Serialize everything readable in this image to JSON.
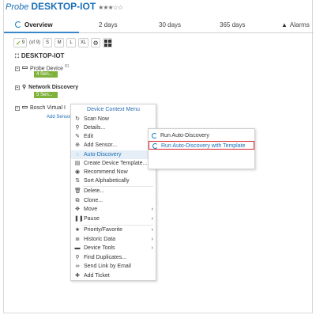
{
  "title": {
    "prefix": "Probe",
    "name": "DESKTOP-IOT",
    "stars": "★★★☆☆"
  },
  "tabs": [
    {
      "label": "Overview",
      "icon": "spinner-icon",
      "active": true
    },
    {
      "label": "2  days",
      "active": false
    },
    {
      "label": "30  days",
      "active": false
    },
    {
      "label": "365  days",
      "active": false
    },
    {
      "label": "Alarms",
      "icon": "warning-icon",
      "active": false
    }
  ],
  "toolbar": {
    "count_badge": "9",
    "of_label": "(of 9)",
    "sizes": [
      "S",
      "M",
      "L",
      "XL"
    ],
    "icons": [
      "gear-icon",
      "grid-icon"
    ]
  },
  "tree": {
    "root": "DESKTOP-IOT",
    "nodes": [
      {
        "label": "Probe Device",
        "sup": "81",
        "sensors": "4 Sen..."
      },
      {
        "label": "Network Discovery",
        "sensors": "5 Sen..."
      },
      {
        "label": "Bosch Virtual I",
        "add_sensor": "Add Sensor"
      }
    ]
  },
  "context_menu": {
    "header": "Device Context Menu",
    "items": [
      {
        "label": "Scan Now",
        "icon": "refresh-icon"
      },
      {
        "label": "Details...",
        "icon": "search-icon"
      },
      {
        "label": "Edit",
        "icon": "edit-icon",
        "submenu": true
      },
      {
        "label": "Add Sensor...",
        "icon": "plus-icon"
      },
      {
        "label": "Auto-Discovery",
        "icon": "spinner-icon",
        "submenu": true,
        "highlighted": true
      },
      {
        "label": "Create Device Template...",
        "icon": "template-icon"
      },
      {
        "label": "Recommend Now",
        "icon": "recommend-icon"
      },
      {
        "label": "Sort Alphabetically",
        "icon": "sort-icon"
      },
      {
        "label": "Delete...",
        "icon": "trash-icon"
      },
      {
        "label": "Clone...",
        "icon": "clone-icon"
      },
      {
        "label": "Move",
        "icon": "move-icon",
        "submenu": true
      },
      {
        "label": "Pause",
        "icon": "pause-icon",
        "submenu": true
      },
      {
        "label": "Priority/Favorite",
        "icon": "star-icon",
        "submenu": true
      },
      {
        "label": "Historic Data",
        "icon": "database-icon",
        "submenu": true
      },
      {
        "label": "Device Tools",
        "icon": "tools-icon",
        "submenu": true
      },
      {
        "label": "Find Duplicates...",
        "icon": "search-icon"
      },
      {
        "label": "Send Link by Email",
        "icon": "link-icon"
      },
      {
        "label": "Add Ticket",
        "icon": "ticket-icon"
      }
    ]
  },
  "auto_discovery_submenu": {
    "items": [
      {
        "label": "Run Auto-Discovery",
        "selected": false
      },
      {
        "label": "Run Auto-Discovery with Template",
        "selected": true
      }
    ]
  },
  "colors": {
    "accent": "#1a6fb5",
    "sensor_green": "#7fb23b",
    "selection_red": "#d7262b"
  }
}
